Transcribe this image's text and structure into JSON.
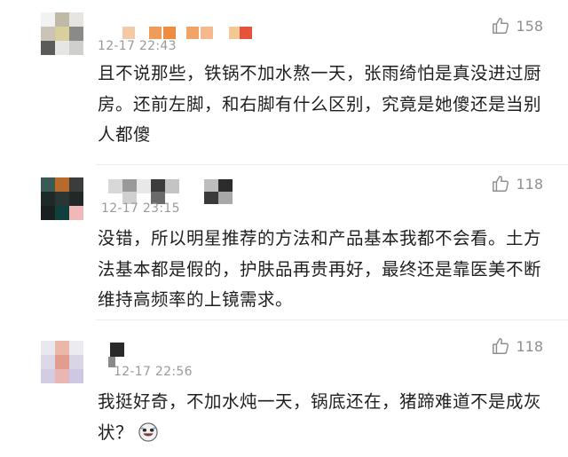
{
  "comments": [
    {
      "time": "12-17 22:43",
      "likes": "158",
      "text": "且不说那些，铁锅不加水熬一天，张雨绮怕是真没进过厨房。还前左脚，和右脚有什么区别，究竟是她傻还是当别人都傻"
    },
    {
      "time": "12-17 23:15",
      "likes": "118",
      "text": "没错，所以明星推荐的方法和产品基本我都不会看。土方法基本都是假的，护肤品再贵再好，最终还是靠医美不断维持高频率的上镜需求。"
    },
    {
      "time": "12-17 22:56",
      "likes": "118",
      "text": "我挺好奇，不加水炖一天，锅底还在，猪蹄难道不是成灰状？",
      "emoji": "laugh-cry-emoji"
    }
  ],
  "colors": {
    "time": "#9a9a9a",
    "text": "#1f1f1f",
    "like": "#8f8f8f"
  }
}
